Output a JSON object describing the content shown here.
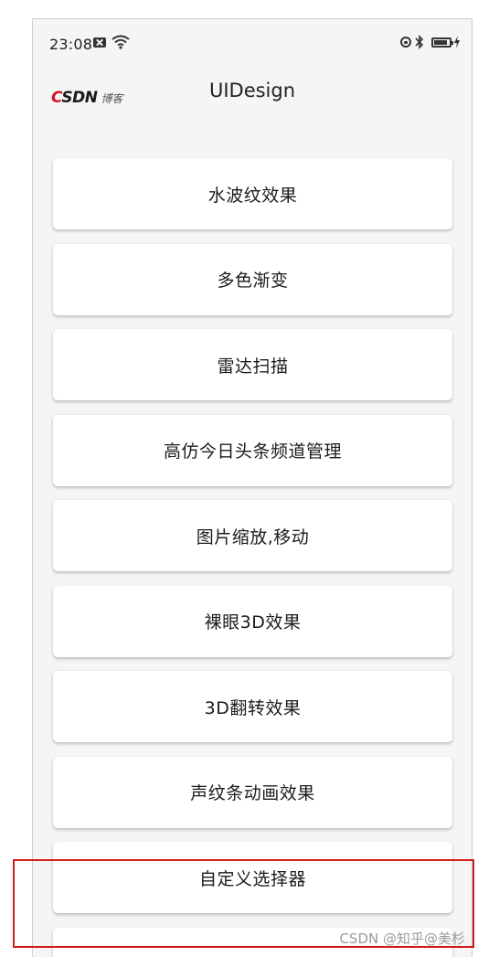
{
  "status_bar": {
    "time": "23:08",
    "icons": [
      "notification-icon",
      "wifi-icon",
      "lock-rotation-icon",
      "bluetooth-icon",
      "battery-icon",
      "charging-icon"
    ]
  },
  "app_bar": {
    "logo_main": "CSDN",
    "logo_sub": "博客",
    "title": "UIDesign"
  },
  "list": {
    "items": [
      {
        "label": "水波纹效果"
      },
      {
        "label": "多色渐变"
      },
      {
        "label": "雷达扫描"
      },
      {
        "label": "高仿今日头条频道管理"
      },
      {
        "label": "图片缩放,移动"
      },
      {
        "label": "裸眼3D效果"
      },
      {
        "label": "3D翻转效果"
      },
      {
        "label": "声纹条动画效果"
      },
      {
        "label": "自定义选择器"
      }
    ]
  },
  "watermark": "CSDN @知乎@美杉",
  "colors": {
    "highlight": "#d21c1c",
    "logo_accent": "#d0112b"
  }
}
